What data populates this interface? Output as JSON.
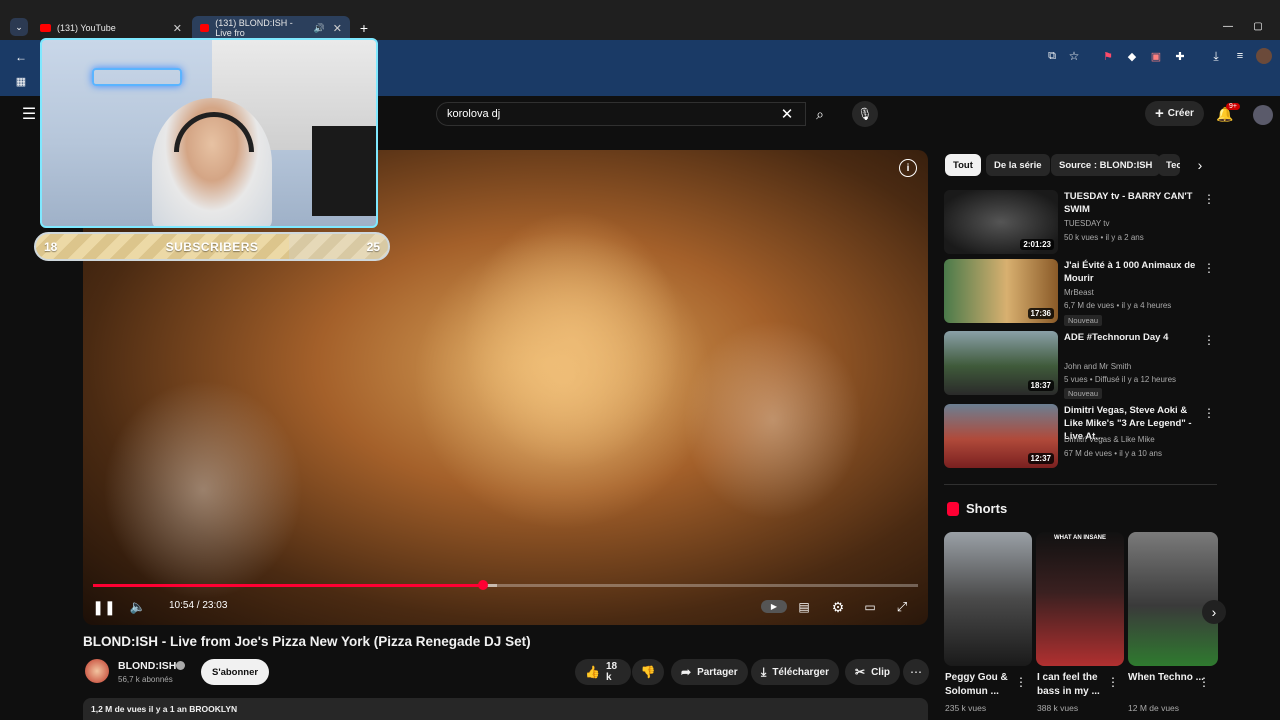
{
  "browser": {
    "tabs": [
      {
        "label": "(131) YouTube"
      },
      {
        "label": "(131) BLOND:ISH - Live fro"
      }
    ],
    "new_tab_icon": "plus-icon"
  },
  "header": {
    "search_value": "korolova dj",
    "create_label": "Créer",
    "notif_count": "9+"
  },
  "overlay": {
    "subscribers_left": "18",
    "subscribers_label": "SUBSCRIBERS",
    "subscribers_right": "25",
    "subscribers_progress": 0.72
  },
  "player": {
    "time": "10:54 / 23:03",
    "progress": 0.473,
    "buffered": 0.49
  },
  "video": {
    "title": "BLOND:ISH - Live from Joe's Pizza New York (Pizza Renegade DJ Set)",
    "channel": "BLOND:ISH",
    "subs": "56,7 k abonnés",
    "subscribe_label": "S'abonner",
    "likes": "18 k",
    "share_label": "Partager",
    "download_label": "Télécharger",
    "clip_label": "Clip",
    "stats": "1,2 M de vues  il y a 1 an  BROOKLYN"
  },
  "chips": [
    {
      "label": "Tout"
    },
    {
      "label": "De la série"
    },
    {
      "label": "Source : BLOND:ISH"
    },
    {
      "label": "Tec"
    }
  ],
  "recommendations": [
    {
      "title": "TUESDAY tv - BARRY CAN'T SWIM",
      "channel": "TUESDAY tv",
      "meta": "50 k vues • il y a 2 ans",
      "duration": "2:01:23",
      "badge": ""
    },
    {
      "title": "J'ai Évité à 1 000 Animaux de Mourir",
      "channel": "MrBeast",
      "meta": "6,7 M de vues • il y a 4 heures",
      "duration": "17:36",
      "badge": "Nouveau"
    },
    {
      "title": "ADE #Technorun  Day 4",
      "channel": "John and Mr Smith",
      "meta": "5 vues • Diffusé il y a 12 heures",
      "duration": "18:37",
      "badge": "Nouveau"
    },
    {
      "title": "Dimitri Vegas, Steve Aoki & Like Mike's \"3 Are Legend\" - Live At...",
      "channel": "Dimitri Vegas & Like Mike",
      "meta": "67 M de vues • il y a 10 ans",
      "duration": "12:37",
      "badge": ""
    }
  ],
  "shorts": {
    "heading": "Shorts",
    "items": [
      {
        "title": "Peggy Gou & Solomun ...",
        "views": "235 k vues"
      },
      {
        "title": "I can feel the bass in my ...",
        "views": "388 k vues"
      },
      {
        "title": "When Techno ...",
        "views": "12 M de vues"
      }
    ],
    "overlay_text": "WHAT AN INSANE"
  },
  "colors": {
    "accent": "#ff0033",
    "background": "#0f0f0f",
    "address_bar": "#1a3a66"
  }
}
